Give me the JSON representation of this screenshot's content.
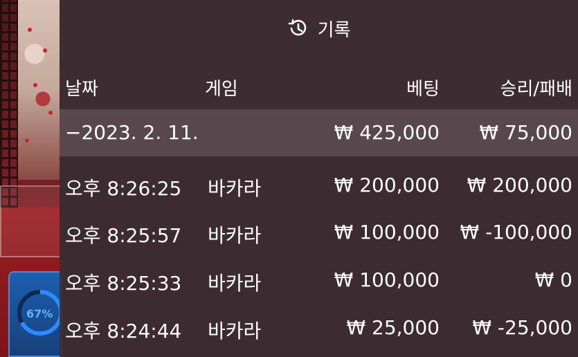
{
  "panel": {
    "title": "기록",
    "icon": "history-icon"
  },
  "columns": {
    "date": "날짜",
    "game": "게임",
    "bet": "베팅",
    "result": "승리/패배"
  },
  "summary": {
    "date": "−2023. 2. 11.",
    "bet": "₩ 425,000",
    "result": "₩ 75,000"
  },
  "rows": [
    {
      "time": "오후 8:26:25",
      "game": "바카라",
      "bet": "₩ 200,000",
      "result": "₩ 200,000"
    },
    {
      "time": "오후 8:25:57",
      "game": "바카라",
      "bet": "₩ 100,000",
      "result": "₩ -100,000"
    },
    {
      "time": "오후 8:25:33",
      "game": "바카라",
      "bet": "₩ 100,000",
      "result": "₩ 0"
    },
    {
      "time": "오후 8:24:44",
      "game": "바카라",
      "bet": "₩ 25,000",
      "result": "₩ -25,000"
    }
  ],
  "progress": {
    "label": "67%",
    "value": 0.67,
    "color": "#2e8bff"
  }
}
